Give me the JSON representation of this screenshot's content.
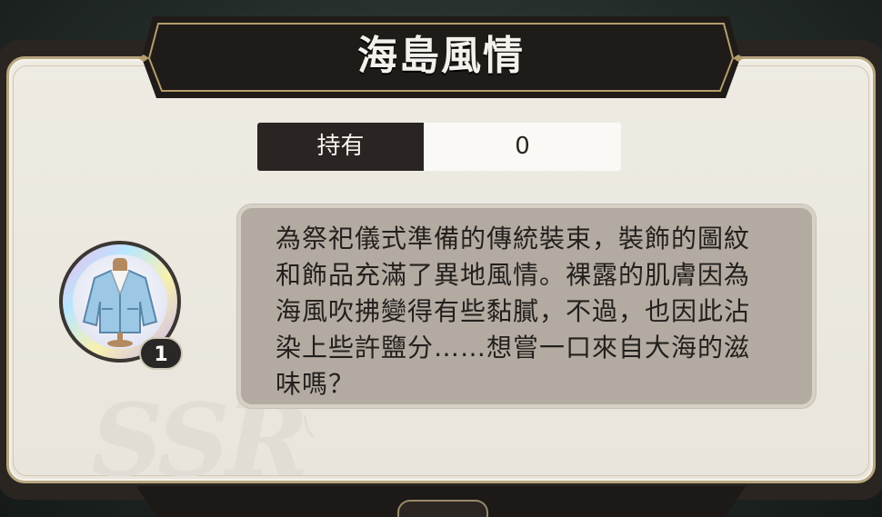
{
  "title": "海島風情",
  "holdings": {
    "label": "持有",
    "value": "0"
  },
  "item": {
    "icon": "jacket-icon",
    "quantity": "1"
  },
  "description": "為祭祀儀式準備的傳統裝束，裝飾的圖紋和飾品充滿了異地風情。裸露的肌膚因為海風吹拂變得有些黏膩，不過，也因此沾染上些許鹽分……想嘗一口來自大海的滋味嗎？",
  "watermark": {
    "text": "SSR",
    "sub": "八"
  },
  "colors": {
    "banner": "#1f1b19",
    "gold_trim": "#b49d6c",
    "panel": "#ece8e0",
    "desc_bg": "#b3aba2"
  }
}
